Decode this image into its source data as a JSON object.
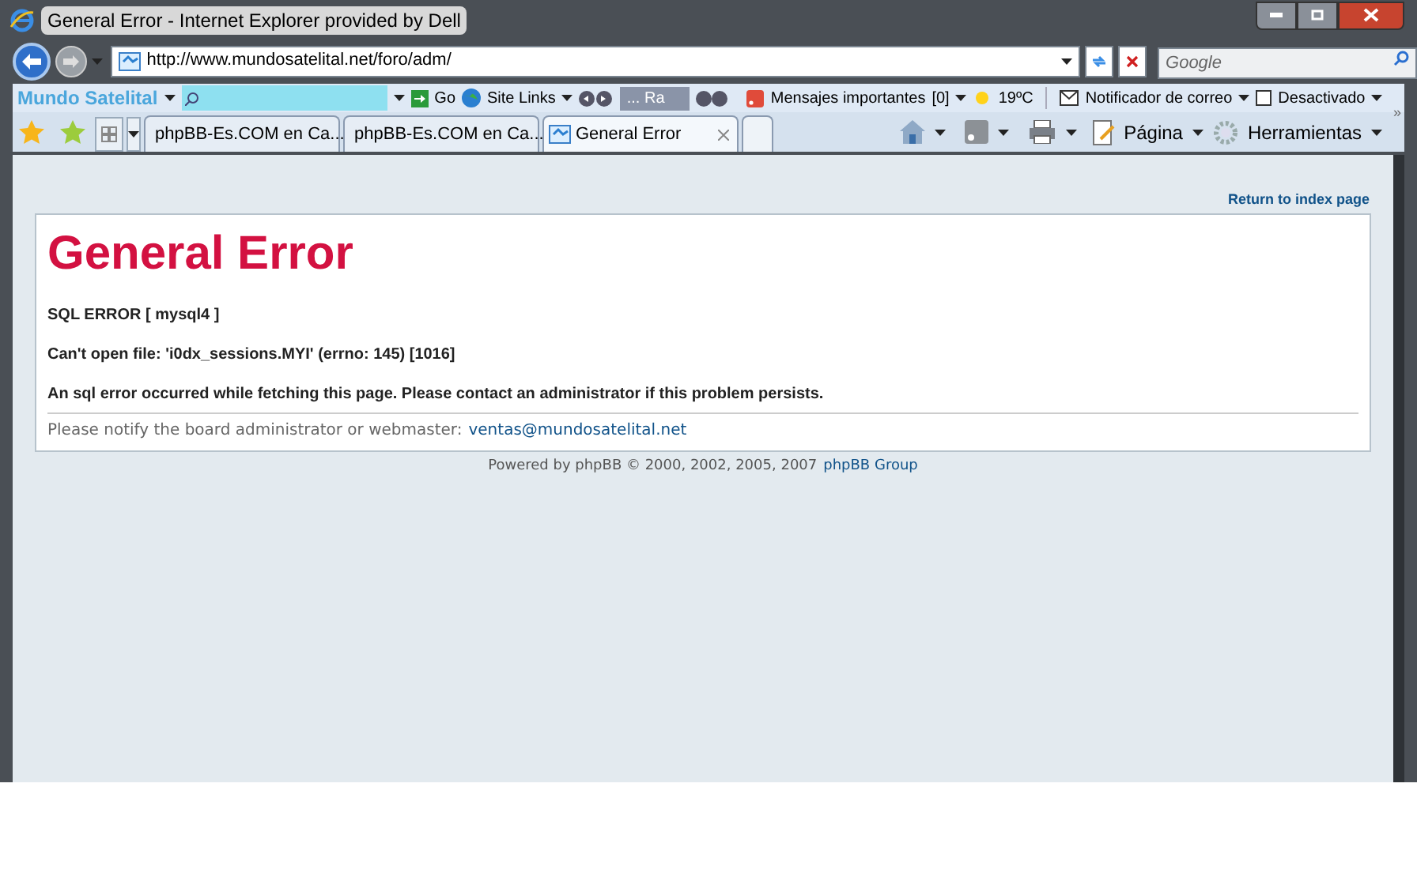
{
  "window": {
    "title": "General Error - Internet Explorer provided by Dell"
  },
  "address_bar": {
    "url": "http://www.mundosatelital.net/foro/adm/"
  },
  "search": {
    "placeholder": "Google"
  },
  "links_toolbar": {
    "brand": "Mundo Satelital",
    "go": "Go",
    "site_links": "Site Links",
    "radio": "... Ra",
    "messages": "Mensajes importantes",
    "message_count": "[0]",
    "weather": "19ºC",
    "mail": "Notificador de correo",
    "status": "Desactivado"
  },
  "tabs": [
    {
      "label": "phpBB-Es.COM en Ca...",
      "selected": false
    },
    {
      "label": "phpBB-Es.COM en Ca...",
      "selected": false
    },
    {
      "label": "General Error",
      "selected": true
    }
  ],
  "command_bar": {
    "more": "»",
    "page": "Página",
    "tools": "Herramientas"
  },
  "page": {
    "return_link": "Return to index page",
    "heading": "General Error",
    "messages": [
      "SQL ERROR [ mysql4 ]",
      "Can't open file: 'i0dx_sessions.MYI' (errno: 145) [1016]",
      "An sql error occurred while fetching this page. Please contact an administrator if this problem persists."
    ],
    "notice": "Please notify the board administrator or webmaster:",
    "email": "ventas@mundosatelital.net",
    "footer": "Powered by phpBB © 2000, 2002, 2005, 2007",
    "footer_link": "phpBB Group"
  }
}
